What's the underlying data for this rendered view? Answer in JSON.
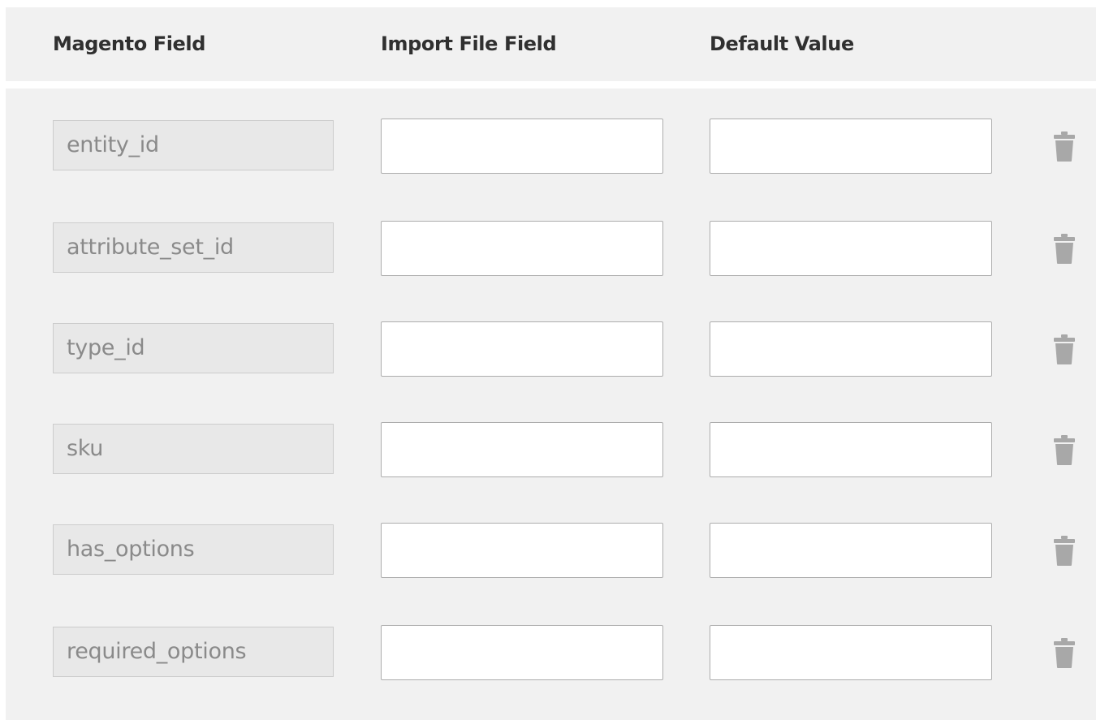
{
  "columns": {
    "magento_field": "Magento Field",
    "import_file_field": "Import File Field",
    "default_value": "Default Value"
  },
  "rows": [
    {
      "magento_field": "entity_id",
      "import_file_field": "",
      "default_value": ""
    },
    {
      "magento_field": "attribute_set_id",
      "import_file_field": "",
      "default_value": ""
    },
    {
      "magento_field": "type_id",
      "import_file_field": "",
      "default_value": ""
    },
    {
      "magento_field": "sku",
      "import_file_field": "",
      "default_value": ""
    },
    {
      "magento_field": "has_options",
      "import_file_field": "",
      "default_value": ""
    },
    {
      "magento_field": "required_options",
      "import_file_field": "",
      "default_value": ""
    }
  ],
  "icons": {
    "delete": "trash-icon"
  },
  "colors": {
    "panel_background": "#f1f1f1",
    "readonly_field_background": "#e8e8e8",
    "readonly_field_text": "#8a8a8a",
    "header_text": "#303030",
    "icon_color": "#a8a8a8"
  }
}
